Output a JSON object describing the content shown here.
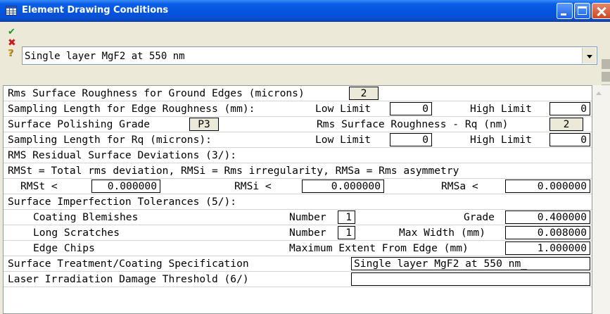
{
  "window": {
    "title": "Element Drawing Conditions"
  },
  "command": {
    "value": "Single layer MgF2 at 550 nm"
  },
  "rows": {
    "r1": {
      "label": "Rms Surface Roughness for Ground Edges (microns)",
      "value": "2"
    },
    "r2": {
      "label": "Sampling Length for Edge Roughness (mm):",
      "low_label": "Low Limit",
      "low_value": "0",
      "high_label": "High Limit",
      "high_value": "0"
    },
    "r3": {
      "label": "Surface Polishing Grade",
      "grade": "P3",
      "rq_label": "Rms Surface Roughness - Rq (nm)",
      "rq_value": "2"
    },
    "r4": {
      "label": "Sampling Length for Rq (microns):",
      "low_label": "Low Limit",
      "low_value": "0",
      "high_label": "High Limit",
      "high_value": "0"
    },
    "r5": {
      "label": "RMS Residual Surface Deviations (3/):"
    },
    "r6": {
      "label": "RMSt = Total rms deviation, RMSi = Rms irregularity, RMSa = Rms asymmetry"
    },
    "r7": {
      "rmst_label": "RMSt  <",
      "rmst_value": "0.000000",
      "rmsi_label": "RMSi  <",
      "rmsi_value": "0.000000",
      "rmsa_label": "RMSa  <",
      "rmsa_value": "0.000000"
    },
    "r8": {
      "label": "Surface Imperfection Tolerances (5/):"
    },
    "r9": {
      "label": "Coating Blemishes",
      "number_label": "Number",
      "number_value": "1",
      "grade_label": "Grade",
      "grade_value": "0.400000"
    },
    "r10": {
      "label": "Long Scratches",
      "number_label": "Number",
      "number_value": "1",
      "width_label": "Max Width (mm)",
      "width_value": "0.008000"
    },
    "r11": {
      "label": "Edge Chips",
      "extent_label": "Maximum Extent From Edge (mm)",
      "extent_value": "1.000000"
    },
    "r12": {
      "label": "Surface Treatment/Coating Specification",
      "value": "Single layer MgF2 at 550 nm_"
    },
    "r13": {
      "label": "Laser Irradiation Damage Threshold (6/)",
      "value": ""
    }
  }
}
